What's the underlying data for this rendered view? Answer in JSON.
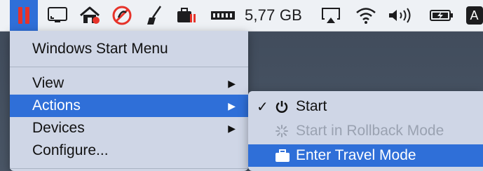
{
  "menubar": {
    "items": [
      {
        "name": "parallels-app-icon"
      },
      {
        "name": "screen-icon"
      },
      {
        "name": "home-alert-icon"
      },
      {
        "name": "no-entry-icon"
      },
      {
        "name": "broom-icon"
      },
      {
        "name": "briefcase-app-icon"
      },
      {
        "name": "memory-icon"
      },
      {
        "name": "airplay-icon"
      },
      {
        "name": "wifi-icon"
      },
      {
        "name": "volume-icon"
      },
      {
        "name": "battery-charging-icon"
      },
      {
        "name": "input-source-icon"
      }
    ],
    "disk_free": "5,77 GB",
    "input_source_label": "A"
  },
  "main_menu": {
    "items": [
      {
        "label": "Windows Start Menu",
        "has_submenu": false
      },
      {
        "label": "View",
        "has_submenu": true
      },
      {
        "label": "Actions",
        "has_submenu": true,
        "highlighted": true
      },
      {
        "label": "Devices",
        "has_submenu": true
      },
      {
        "label": "Configure...",
        "has_submenu": false
      }
    ]
  },
  "submenu": {
    "items": [
      {
        "label": "Start",
        "checked": true,
        "icon": "power-icon"
      },
      {
        "label": "Start in Rollback Mode",
        "disabled": true,
        "icon": "spinner-icon"
      },
      {
        "label": "Enter Travel Mode",
        "highlighted": true,
        "icon": "suitcase-icon"
      }
    ]
  },
  "colors": {
    "highlight": "#2f6fd8",
    "menu_bg": "#cfd6e6",
    "menubar_bg": "#eef1f5",
    "parallels_red": "#e6332a"
  }
}
